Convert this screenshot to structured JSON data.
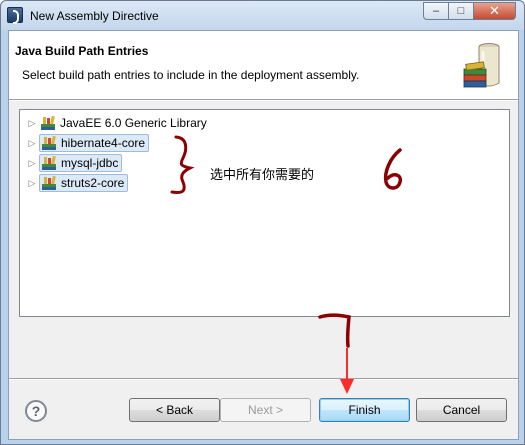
{
  "window": {
    "title": "New Assembly Directive",
    "controls": {
      "minimize": "–",
      "maximize": "□",
      "close": "✕"
    }
  },
  "header": {
    "title": "Java Build Path Entries",
    "message": "Select build path entries to include in the deployment assembly.",
    "graphic_icon": "library-jar-icon"
  },
  "tree": {
    "items": [
      {
        "label": "JavaEE 6.0 Generic Library",
        "selected": false,
        "expanded": false
      },
      {
        "label": "hibernate4-core",
        "selected": true,
        "expanded": false
      },
      {
        "label": "mysql-jdbc",
        "selected": true,
        "expanded": false
      },
      {
        "label": "struts2-core",
        "selected": true,
        "expanded": false
      }
    ]
  },
  "annotations": {
    "note": "选中所有你需要的",
    "step_select": "6",
    "step_finish": "7",
    "ink_color": "#8b0000",
    "arrow_color": "#ff2a2a"
  },
  "buttons": {
    "help": "?",
    "back": "< Back",
    "next": "Next >",
    "finish": "Finish",
    "cancel": "Cancel"
  },
  "colors": {
    "title_bar": "#c3d6ec",
    "selection": "#dceaf8",
    "default_button": "#bee6fd"
  }
}
